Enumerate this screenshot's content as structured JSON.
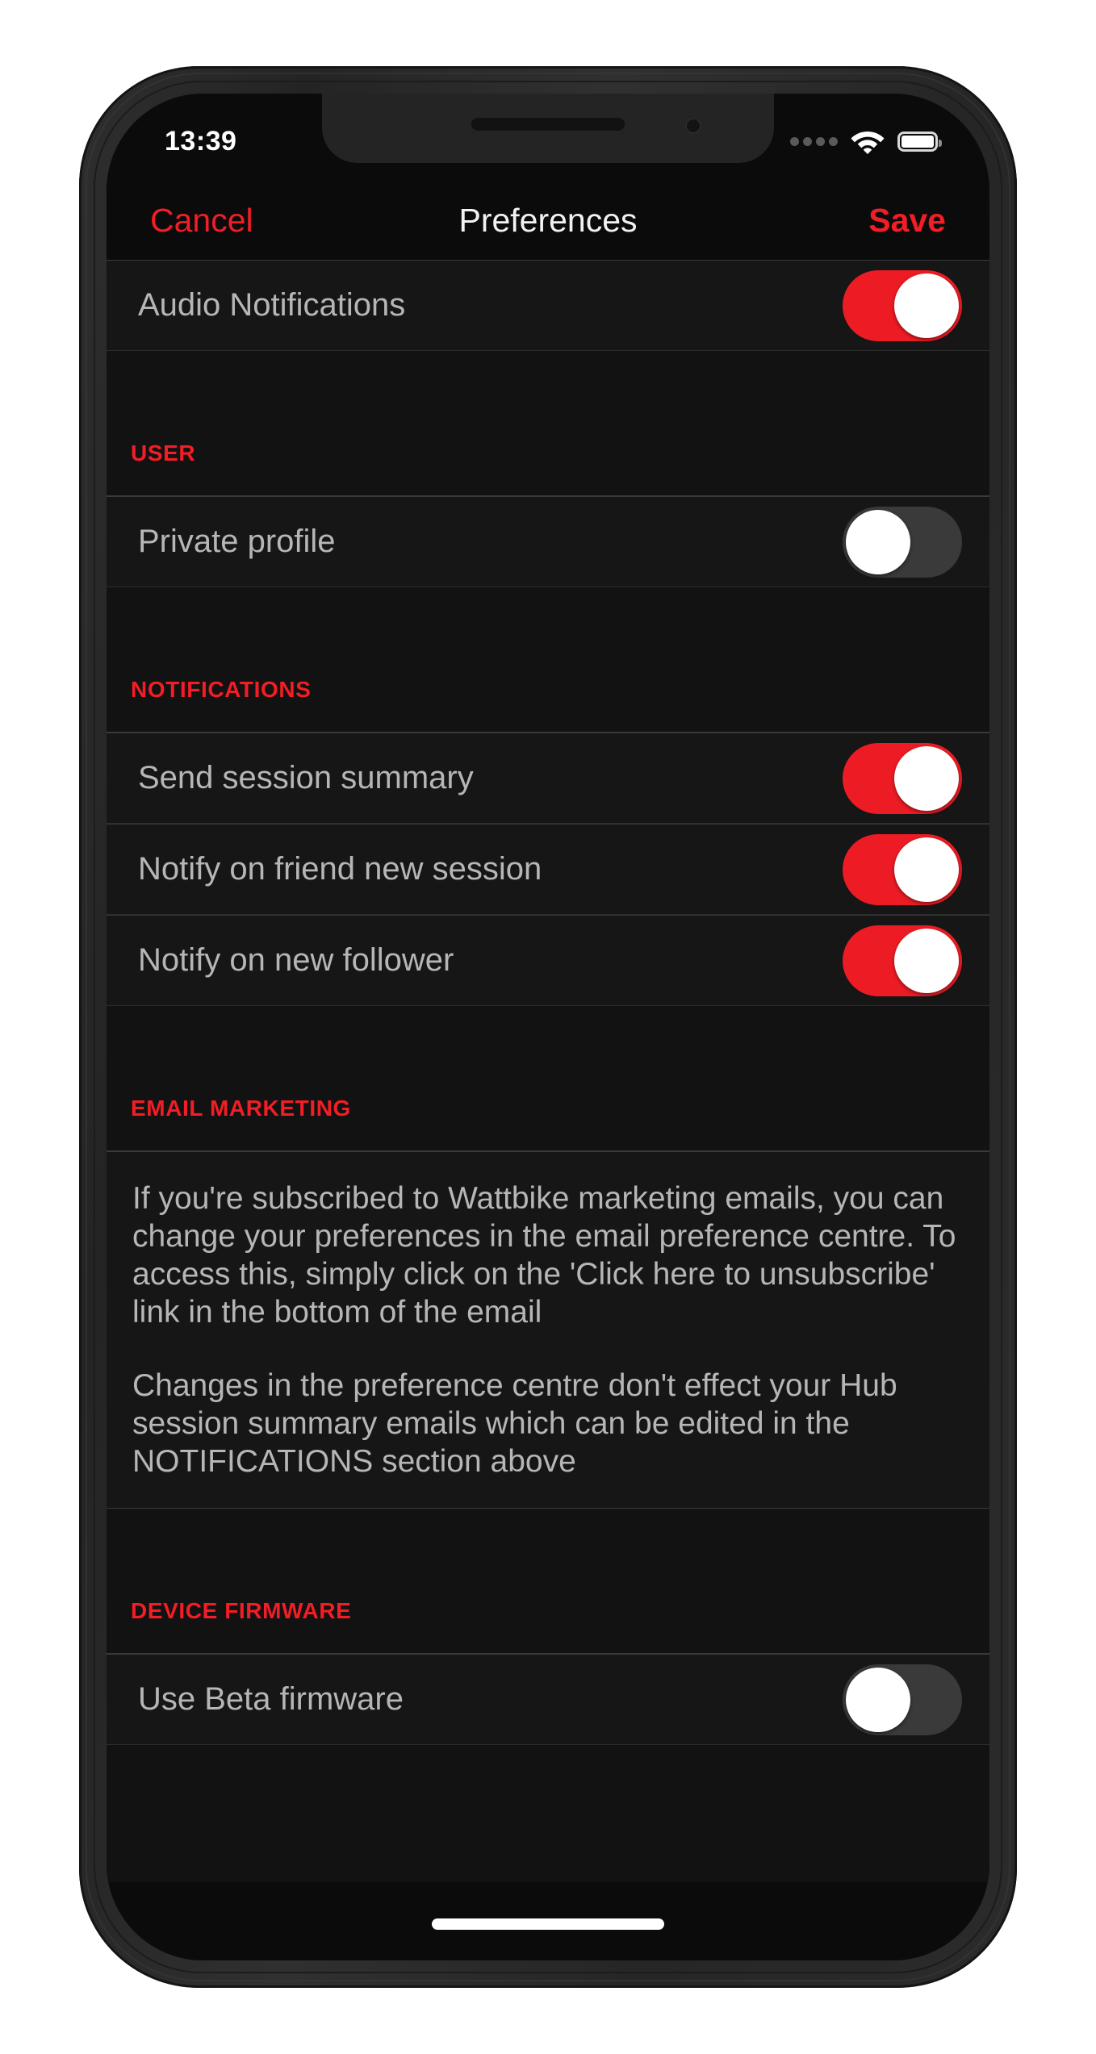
{
  "status_bar": {
    "time": "13:39",
    "signal_icon": "signal-dots-icon",
    "signal_dots": 4,
    "wifi_icon": "wifi-icon",
    "battery_icon": "battery-full-icon",
    "battery_level_pct": 100
  },
  "nav_bar": {
    "cancel_label": "Cancel",
    "title": "Preferences",
    "save_label": "Save"
  },
  "colors": {
    "accent": "#ED1C24",
    "accent_text": "#F31D25",
    "screen_bg": "#0B0B0B",
    "row_bg": "#161616",
    "label_text": "#B6B6B6",
    "title_text": "#F2F2F2",
    "toggle_off_track": "#3A3A3A",
    "toggle_knob": "#FFFFFF"
  },
  "sections": [
    {
      "header": "",
      "rows": [
        {
          "label": "Audio Notifications",
          "toggle": "on"
        }
      ]
    },
    {
      "header": "USER",
      "rows": [
        {
          "label": "Private profile",
          "toggle": "off"
        }
      ]
    },
    {
      "header": "NOTIFICATIONS",
      "rows": [
        {
          "label": "Send session summary",
          "toggle": "on"
        },
        {
          "label": "Notify on friend new session",
          "toggle": "on"
        },
        {
          "label": "Notify on new follower",
          "toggle": "on"
        }
      ]
    },
    {
      "header": "EMAIL MARKETING",
      "paragraphs": [
        "If you're subscribed to Wattbike marketing emails, you can change your preferences in the email preference centre. To access this, simply click on the 'Click here to unsubscribe' link in the bottom of the email",
        "Changes in the preference centre don't effect your Hub session summary emails which can be edited in the NOTIFICATIONS section above"
      ]
    },
    {
      "header": "DEVICE FIRMWARE",
      "rows": [
        {
          "label": "Use Beta firmware",
          "toggle": "off"
        }
      ]
    }
  ],
  "home_indicator": "home-indicator-bar"
}
